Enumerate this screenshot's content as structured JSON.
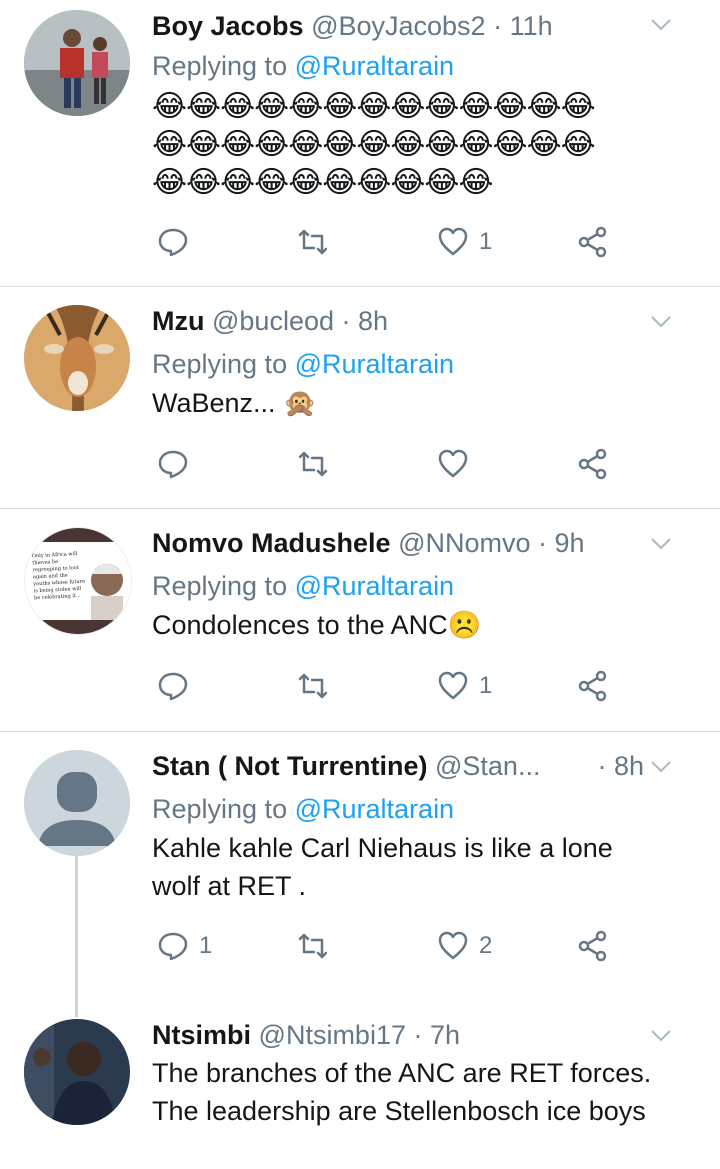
{
  "colors": {
    "link": "#1da1f2",
    "secondary": "#657786",
    "divider": "#d8dde1",
    "icon": "#657786"
  },
  "tweets": [
    {
      "name": "Boy Jacobs",
      "handle": "@BoyJacobs2",
      "time": "· 11h",
      "replying_prefix": "Replying to",
      "replying_to": "@Ruraltarain",
      "emoji_rows": [
        "😂😂😂😂😂😂😂😂😂😂😂😂😂",
        "😂😂😂😂😂😂😂😂😂😂😂😂😂",
        "😂😂😂😂😂😂😂😂😂😂"
      ],
      "replies": "",
      "retweets": "",
      "likes": "1"
    },
    {
      "name": "Mzu",
      "handle": "@bucleod",
      "time": "· 8h",
      "replying_prefix": "Replying to",
      "replying_to": "@Ruraltarain",
      "text": "WaBenz... 🙊",
      "replies": "",
      "retweets": "",
      "likes": ""
    },
    {
      "name": "Nomvo Madushele",
      "handle": "@NNomvo",
      "time": "· 9h",
      "replying_prefix": "Replying to",
      "replying_to": "@Ruraltarain",
      "text": "Condolences to the ANC☹️",
      "avatar_quote": "Only in Africa will thieves be regrouping to loot again and the youths whose future is being stolen will be celebrating it...",
      "replies": "",
      "retweets": "",
      "likes": "1"
    },
    {
      "name": "Stan ( Not Turrentine)",
      "handle": "@Stan...",
      "time": "· 8h",
      "replying_prefix": "Replying to",
      "replying_to": "@Ruraltarain",
      "text": "Kahle kahle Carl Niehaus is like a lone wolf at RET .",
      "replies": "1",
      "retweets": "",
      "likes": "2"
    },
    {
      "name": "Ntsimbi",
      "handle": "@Ntsimbi17",
      "time": "· 7h",
      "text": "The branches of the ANC are RET forces. The leadership are Stellenbosch ice boys"
    }
  ]
}
